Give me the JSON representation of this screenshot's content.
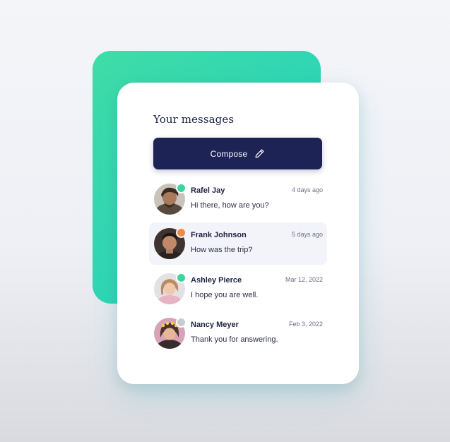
{
  "panel": {
    "title": "Your messages",
    "compose_label": "Compose",
    "compose_icon": "pencil-icon"
  },
  "colors": {
    "accent_green": "#3fdca6",
    "compose_bg": "#1e2356",
    "status_online": "#3fd3a0",
    "status_away": "#f08a3e",
    "status_offline": "#c9cbd3"
  },
  "messages": [
    {
      "name": "Rafel Jay",
      "time": "4 days ago",
      "preview": "Hi there, how are you?",
      "status": "online"
    },
    {
      "name": "Frank  Johnson",
      "time": "5 days ago",
      "preview": "How was the trip?",
      "status": "away"
    },
    {
      "name": "Ashley Pierce",
      "time": "Mar 12, 2022",
      "preview": "I hope you are well.",
      "status": "online"
    },
    {
      "name": "Nancy Meyer",
      "time": "Feb 3, 2022",
      "preview": "Thank you for answering.",
      "status": "offline"
    }
  ]
}
